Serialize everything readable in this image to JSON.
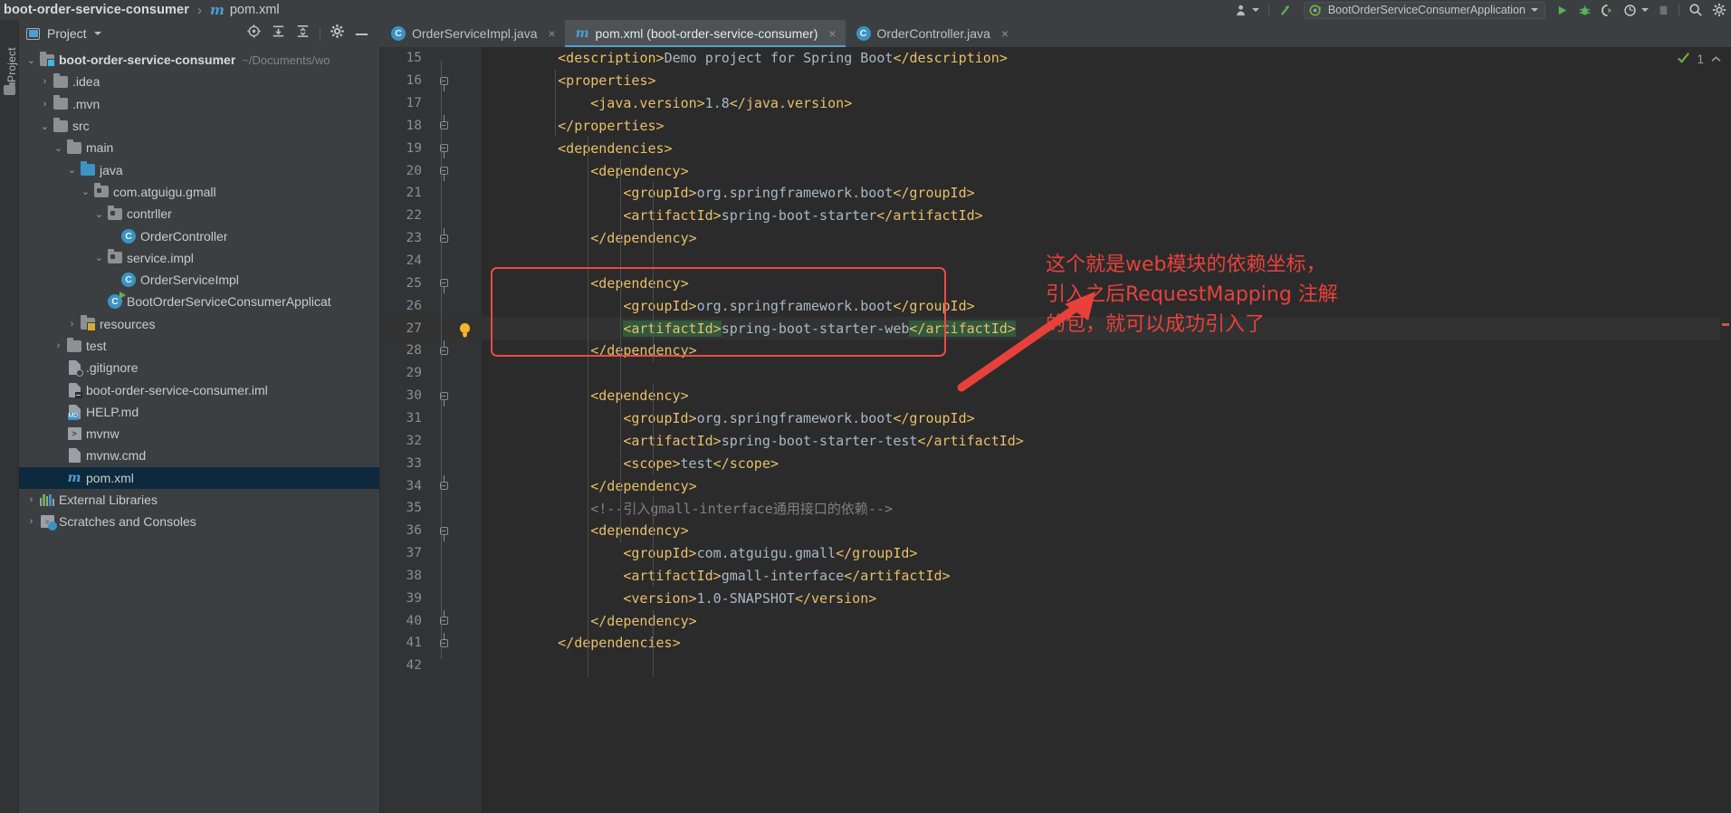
{
  "breadcrumb": {
    "project": "boot-order-service-consumer",
    "separator": "›",
    "file": "pom.xml",
    "file_icon": "maven-m-icon"
  },
  "toolbar": {
    "user_icon": "user-avatar-icon",
    "updates_icon": "update-arrow-icon",
    "run_config": {
      "icon": "spring-boot-run-icon",
      "label": "BootOrderServiceConsumerApplication",
      "dropdown_icon": "chevron-down-icon"
    },
    "run_icon": "run-play-icon",
    "debug_icon": "debug-bug-icon",
    "run_coverage_icon": "run-with-coverage-icon",
    "profiler_icon": "profiler-icon",
    "profiler_dropdown_icon": "chevron-down-icon",
    "stop_icon": "stop-icon",
    "search_icon": "search-icon",
    "settings_icon": "gear-icon"
  },
  "left_strip": {
    "label": "Project",
    "structure_icon": "structure-icon"
  },
  "project_panel": {
    "icon": "project-view-icon",
    "title": "Project",
    "dropdown_icon": "chevron-down-icon",
    "actions": [
      {
        "name": "locate-icon",
        "glyph": "⊕"
      },
      {
        "name": "expand-all-icon",
        "glyph": "⤓"
      },
      {
        "name": "collapse-all-icon",
        "glyph": "⤒"
      },
      {
        "name": "settings-gear-icon",
        "glyph": "⚙"
      },
      {
        "name": "hide-panel-icon",
        "glyph": "−"
      }
    ]
  },
  "tree": [
    {
      "id": "root",
      "label": "boot-order-service-consumer",
      "sub": "~/Documents/wo",
      "depth": 0,
      "arrow": "down",
      "icon": "module-folder-icon",
      "bold": true,
      "selected": false
    },
    {
      "id": "idea",
      "label": ".idea",
      "sub": "",
      "depth": 1,
      "arrow": "right",
      "icon": "folder-icon",
      "bold": false,
      "selected": false
    },
    {
      "id": "mvn",
      "label": ".mvn",
      "sub": "",
      "depth": 1,
      "arrow": "right",
      "icon": "folder-icon",
      "bold": false,
      "selected": false
    },
    {
      "id": "src",
      "label": "src",
      "sub": "",
      "depth": 1,
      "arrow": "down",
      "icon": "folder-icon",
      "bold": false,
      "selected": false
    },
    {
      "id": "main",
      "label": "main",
      "sub": "",
      "depth": 2,
      "arrow": "down",
      "icon": "folder-icon",
      "bold": false,
      "selected": false
    },
    {
      "id": "java",
      "label": "java",
      "sub": "",
      "depth": 3,
      "arrow": "down",
      "icon": "source-folder-icon",
      "bold": false,
      "selected": false
    },
    {
      "id": "pkg",
      "label": "com.atguigu.gmall",
      "sub": "",
      "depth": 4,
      "arrow": "down",
      "icon": "package-icon",
      "bold": false,
      "selected": false
    },
    {
      "id": "contrller",
      "label": "contrller",
      "sub": "",
      "depth": 5,
      "arrow": "down",
      "icon": "package-icon",
      "bold": false,
      "selected": false
    },
    {
      "id": "ordercontroller",
      "label": "OrderController",
      "sub": "",
      "depth": 6,
      "arrow": "none",
      "icon": "java-class-icon",
      "bold": false,
      "selected": false
    },
    {
      "id": "serviceimplpkg",
      "label": "service.impl",
      "sub": "",
      "depth": 5,
      "arrow": "down",
      "icon": "package-icon",
      "bold": false,
      "selected": false
    },
    {
      "id": "orderserviceimpl",
      "label": "OrderServiceImpl",
      "sub": "",
      "depth": 6,
      "arrow": "none",
      "icon": "java-class-icon",
      "bold": false,
      "selected": false
    },
    {
      "id": "bootapp",
      "label": "BootOrderServiceConsumerApplicat",
      "sub": "",
      "depth": 5,
      "arrow": "none",
      "icon": "spring-boot-class-icon",
      "bold": false,
      "selected": false
    },
    {
      "id": "resources",
      "label": "resources",
      "sub": "",
      "depth": 3,
      "arrow": "right",
      "icon": "resources-folder-icon",
      "bold": false,
      "selected": false
    },
    {
      "id": "test",
      "label": "test",
      "sub": "",
      "depth": 2,
      "arrow": "right",
      "icon": "folder-icon",
      "bold": false,
      "selected": false
    },
    {
      "id": "gitignore",
      "label": ".gitignore",
      "sub": "",
      "depth": 2,
      "arrow": "none",
      "icon": "gitignore-file-icon",
      "bold": false,
      "selected": false
    },
    {
      "id": "iml",
      "label": "boot-order-service-consumer.iml",
      "sub": "",
      "depth": 2,
      "arrow": "none",
      "icon": "iml-file-icon",
      "bold": false,
      "selected": false
    },
    {
      "id": "help",
      "label": "HELP.md",
      "sub": "",
      "depth": 2,
      "arrow": "none",
      "icon": "markdown-file-icon",
      "bold": false,
      "selected": false
    },
    {
      "id": "mvnw",
      "label": "mvnw",
      "sub": "",
      "depth": 2,
      "arrow": "none",
      "icon": "shell-script-icon",
      "bold": false,
      "selected": false
    },
    {
      "id": "mvnwcmd",
      "label": "mvnw.cmd",
      "sub": "",
      "depth": 2,
      "arrow": "none",
      "icon": "cmd-file-icon",
      "bold": false,
      "selected": false
    },
    {
      "id": "pomxml",
      "label": "pom.xml",
      "sub": "",
      "depth": 2,
      "arrow": "none",
      "icon": "maven-m-icon",
      "bold": false,
      "selected": true
    },
    {
      "id": "extlibs",
      "label": "External Libraries",
      "sub": "",
      "depth": 0,
      "arrow": "right",
      "icon": "external-libraries-icon",
      "bold": false,
      "selected": false
    },
    {
      "id": "scratches",
      "label": "Scratches and Consoles",
      "sub": "",
      "depth": 0,
      "arrow": "right",
      "icon": "scratches-icon",
      "bold": false,
      "selected": false
    }
  ],
  "tabs": [
    {
      "id": "tab1",
      "label": "OrderServiceImpl.java",
      "icon": "java-class-icon",
      "active": false,
      "close_icon": "close-icon"
    },
    {
      "id": "tab2",
      "label": "pom.xml (boot-order-service-consumer)",
      "icon": "maven-m-icon",
      "active": true,
      "close_icon": "close-icon"
    },
    {
      "id": "tab3",
      "label": "OrderController.java",
      "icon": "java-class-icon",
      "active": false,
      "close_icon": "close-icon"
    }
  ],
  "editor": {
    "inspection": {
      "count": "1",
      "check_icon": "inspection-ok-icon",
      "collapse_icon": "chevron-up-icon"
    },
    "lines": [
      {
        "n": "15",
        "fold": "none",
        "indent": 2,
        "segments": [
          {
            "t": "tag",
            "v": "<description>"
          },
          {
            "t": "txt",
            "v": "Demo project for Spring Boot"
          },
          {
            "t": "tag",
            "v": "</description>"
          }
        ]
      },
      {
        "n": "16",
        "fold": "open",
        "indent": 2,
        "segments": [
          {
            "t": "tag",
            "v": "<properties>"
          }
        ]
      },
      {
        "n": "17",
        "fold": "none",
        "indent": 3,
        "segments": [
          {
            "t": "tag",
            "v": "<java.version>"
          },
          {
            "t": "txt",
            "v": "1.8"
          },
          {
            "t": "tag",
            "v": "</java.version>"
          }
        ]
      },
      {
        "n": "18",
        "fold": "close",
        "indent": 2,
        "segments": [
          {
            "t": "tag",
            "v": "</properties>"
          }
        ]
      },
      {
        "n": "19",
        "fold": "open",
        "indent": 2,
        "segments": [
          {
            "t": "tag",
            "v": "<dependencies>"
          }
        ]
      },
      {
        "n": "20",
        "fold": "open",
        "indent": 3,
        "segments": [
          {
            "t": "tag",
            "v": "<dependency>"
          }
        ]
      },
      {
        "n": "21",
        "fold": "none",
        "indent": 4,
        "segments": [
          {
            "t": "tag",
            "v": "<groupId>"
          },
          {
            "t": "txt",
            "v": "org.springframework.boot"
          },
          {
            "t": "tag",
            "v": "</groupId>"
          }
        ]
      },
      {
        "n": "22",
        "fold": "none",
        "indent": 4,
        "segments": [
          {
            "t": "tag",
            "v": "<artifactId>"
          },
          {
            "t": "txt",
            "v": "spring-boot-starter"
          },
          {
            "t": "tag",
            "v": "</artifactId>"
          }
        ]
      },
      {
        "n": "23",
        "fold": "close",
        "indent": 3,
        "segments": [
          {
            "t": "tag",
            "v": "</dependency>"
          }
        ]
      },
      {
        "n": "24",
        "fold": "none",
        "indent": 0,
        "segments": []
      },
      {
        "n": "25",
        "fold": "open",
        "indent": 3,
        "segments": [
          {
            "t": "tag",
            "v": "<dependency>"
          }
        ]
      },
      {
        "n": "26",
        "fold": "none",
        "indent": 4,
        "segments": [
          {
            "t": "tag",
            "v": "<groupId>"
          },
          {
            "t": "txt",
            "v": "org.springframework.boot"
          },
          {
            "t": "tag",
            "v": "</groupId>"
          }
        ]
      },
      {
        "n": "27",
        "fold": "none",
        "indent": 4,
        "bulb": true,
        "current": true,
        "segments": [
          {
            "t": "hl-tag",
            "v": "<artifactId>"
          },
          {
            "t": "txt",
            "v": "spring-boot-starter-web"
          },
          {
            "t": "hl-tag",
            "v": "</artifactId>"
          }
        ]
      },
      {
        "n": "28",
        "fold": "close",
        "indent": 3,
        "segments": [
          {
            "t": "tag",
            "v": "</dependency>"
          }
        ]
      },
      {
        "n": "29",
        "fold": "none",
        "indent": 0,
        "segments": []
      },
      {
        "n": "30",
        "fold": "open",
        "indent": 3,
        "segments": [
          {
            "t": "tag",
            "v": "<dependency>"
          }
        ]
      },
      {
        "n": "31",
        "fold": "none",
        "indent": 4,
        "segments": [
          {
            "t": "tag",
            "v": "<groupId>"
          },
          {
            "t": "txt",
            "v": "org.springframework.boot"
          },
          {
            "t": "tag",
            "v": "</groupId>"
          }
        ]
      },
      {
        "n": "32",
        "fold": "none",
        "indent": 4,
        "segments": [
          {
            "t": "tag",
            "v": "<artifactId>"
          },
          {
            "t": "txt",
            "v": "spring-boot-starter-test"
          },
          {
            "t": "tag",
            "v": "</artifactId>"
          }
        ]
      },
      {
        "n": "33",
        "fold": "none",
        "indent": 4,
        "segments": [
          {
            "t": "tag",
            "v": "<scope>"
          },
          {
            "t": "txt",
            "v": "test"
          },
          {
            "t": "tag",
            "v": "</scope>"
          }
        ]
      },
      {
        "n": "34",
        "fold": "close",
        "indent": 3,
        "segments": [
          {
            "t": "tag",
            "v": "</dependency>"
          }
        ]
      },
      {
        "n": "35",
        "fold": "none",
        "indent": 3,
        "segments": [
          {
            "t": "cmt",
            "v": "<!--引入gmall-interface通用接口的依赖-->"
          }
        ]
      },
      {
        "n": "36",
        "fold": "open",
        "indent": 3,
        "segments": [
          {
            "t": "tag",
            "v": "<dependency>"
          }
        ]
      },
      {
        "n": "37",
        "fold": "none",
        "indent": 4,
        "segments": [
          {
            "t": "tag",
            "v": "<groupId>"
          },
          {
            "t": "txt",
            "v": "com.atguigu.gmall"
          },
          {
            "t": "tag",
            "v": "</groupId>"
          }
        ]
      },
      {
        "n": "38",
        "fold": "none",
        "indent": 4,
        "segments": [
          {
            "t": "tag",
            "v": "<artifactId>"
          },
          {
            "t": "txt",
            "v": "gmall-interface"
          },
          {
            "t": "tag",
            "v": "</artifactId>"
          }
        ]
      },
      {
        "n": "39",
        "fold": "none",
        "indent": 4,
        "segments": [
          {
            "t": "tag",
            "v": "<version>"
          },
          {
            "t": "txt",
            "v": "1.0-SNAPSHOT"
          },
          {
            "t": "tag",
            "v": "</version>"
          }
        ]
      },
      {
        "n": "40",
        "fold": "close",
        "indent": 3,
        "segments": [
          {
            "t": "tag",
            "v": "</dependency>"
          }
        ]
      },
      {
        "n": "41",
        "fold": "close",
        "indent": 2,
        "segments": [
          {
            "t": "tag",
            "v": "</dependencies>"
          }
        ]
      },
      {
        "n": "42",
        "fold": "none",
        "indent": 0,
        "segments": []
      }
    ]
  },
  "annotation": {
    "color": "#e8413c",
    "arrow_icon": "red-arrow-icon",
    "box_icon": "red-highlight-box",
    "lines": [
      "这个就是web模块的依赖坐标，",
      "引入之后RequestMapping 注解",
      "的包，就可以成功引入了"
    ]
  }
}
